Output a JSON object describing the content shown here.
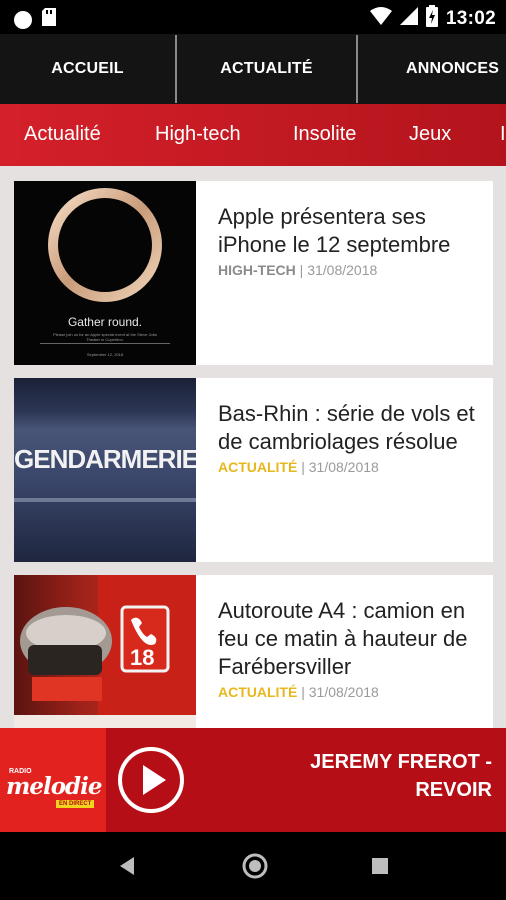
{
  "status_bar": {
    "time": "13:02",
    "icons": [
      "circle-icon",
      "sd-card-icon",
      "wifi-icon",
      "signal-icon",
      "battery-charging-icon"
    ]
  },
  "top_nav": {
    "tabs": [
      {
        "label": "ACCUEIL"
      },
      {
        "label": "ACTUALITÉ"
      },
      {
        "label": "ANNONCES"
      }
    ]
  },
  "categories": {
    "items": [
      {
        "label": "Actualité"
      },
      {
        "label": "High-tech"
      },
      {
        "label": "Insolite"
      },
      {
        "label": "Jeux"
      }
    ]
  },
  "articles": [
    {
      "title": "Apple présentera ses iPhone le 12 septembre",
      "category": "HIGH-TECH",
      "category_color": "#8a8a8a",
      "date": "31/08/2018",
      "image_text": "Gather round.",
      "image_subtext": "Please join us for an Apple special event at the Steve Jobs Theater in Cupertino.",
      "image_date": "September 12, 2018"
    },
    {
      "title": "Bas-Rhin : série de vols et de cambriolages résolue",
      "category": "ACTUALITÉ",
      "category_color": "#e7b81e",
      "date": "31/08/2018",
      "image_text": "GENDARMERIE"
    },
    {
      "title": "Autoroute A4 : camion en feu ce matin à hauteur de Farébersviller",
      "category": "ACTUALITÉ",
      "category_color": "#e7b81e",
      "date": "31/08/2018",
      "image_text": "18"
    }
  ],
  "player": {
    "logo_top": "RADIO",
    "logo_main": "melodie",
    "logo_badge": "EN DIRECT",
    "artist": "JEREMY FREROT -",
    "song": "REVOIR"
  },
  "colors": {
    "accent_red": "#d4202a",
    "player_red": "#b50e16",
    "nav_dark": "#141414",
    "feed_bg": "#e6e1e1",
    "actualite_yellow": "#e7b81e"
  }
}
